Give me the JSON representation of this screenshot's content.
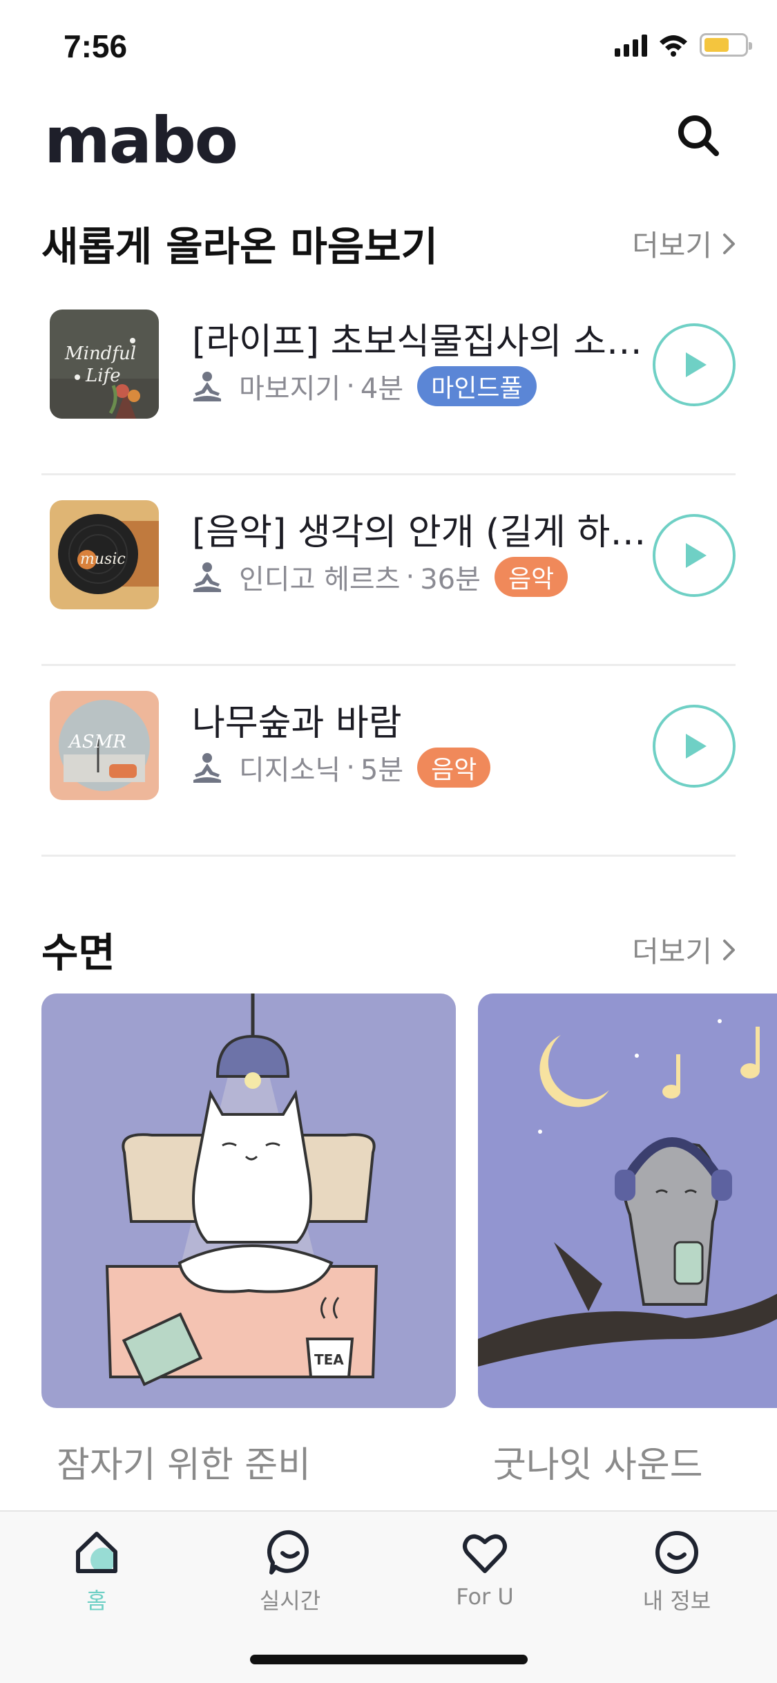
{
  "status_bar": {
    "time": "7:56"
  },
  "header": {
    "brand": "mabo"
  },
  "new_section": {
    "title": "새롭게 올라온 마음보기",
    "more": "더보기",
    "items": [
      {
        "title": "[라이프] 초보식물집사의 소…",
        "author": "마보지기",
        "duration": "4분",
        "tag": "마인드풀",
        "tag_color": "#5b86d6",
        "thumb_text": "Mindful Life"
      },
      {
        "title": "[음악] 생각의 안개 (길게 하…",
        "author": "인디고 헤르츠",
        "duration": "36분",
        "tag": "음악",
        "tag_color": "#f0895a",
        "thumb_text": "music"
      },
      {
        "title": "나무숲과 바람",
        "author": "디지소닉",
        "duration": "5분",
        "tag": "음악",
        "tag_color": "#f0895a",
        "thumb_text": "ASMR"
      }
    ]
  },
  "sleep_section": {
    "title": "수면",
    "more": "더보기",
    "cards": [
      {
        "label": "잠자기 위한 준비",
        "bg": "#9ea0cf",
        "cup_text": "TEA"
      },
      {
        "label": "굿나잇 사운드",
        "bg": "#9295d0"
      }
    ]
  },
  "tab_bar": {
    "tabs": [
      {
        "label": "홈",
        "icon": "home-icon",
        "active": true
      },
      {
        "label": "실시간",
        "icon": "chat-bubble-icon",
        "active": false
      },
      {
        "label": "For U",
        "icon": "heart-icon",
        "active": false
      },
      {
        "label": "내 정보",
        "icon": "smile-face-icon",
        "active": false
      }
    ]
  },
  "colors": {
    "accent": "#6fd0c5",
    "tag_blue": "#5b86d6",
    "tag_orange": "#f0895a"
  }
}
